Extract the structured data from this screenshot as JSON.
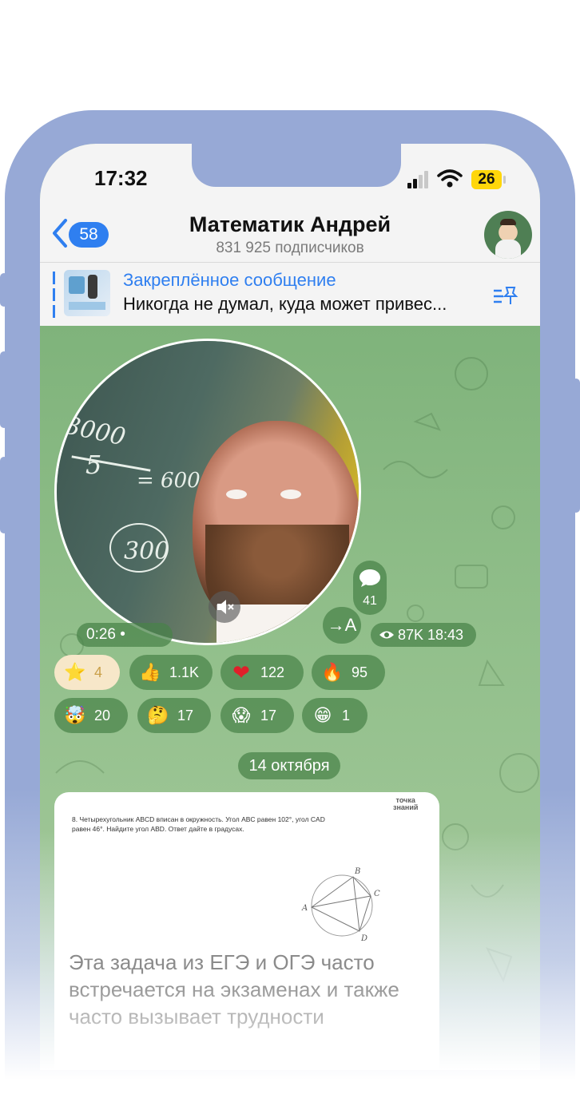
{
  "status_bar": {
    "time": "17:32",
    "battery": "26"
  },
  "header": {
    "back_count": "58",
    "title": "Математик Андрей",
    "subtitle": "831 925 подписчиков"
  },
  "pinned": {
    "title": "Закреплённое сообщение",
    "text": "Никогда не думал, куда может привес..."
  },
  "video_message": {
    "chalk": [
      "3000",
      "5",
      "= 600",
      "300"
    ],
    "duration": "0:26 •",
    "comments": "41",
    "translate_label": "→A",
    "views_time": "87K 18:43"
  },
  "reactions": [
    {
      "emoji": "⭐",
      "count": "4",
      "active": true
    },
    {
      "emoji": "👍",
      "count": "1.1K"
    },
    {
      "emoji": "❤",
      "count": "122"
    },
    {
      "emoji": "🔥",
      "count": "95"
    },
    {
      "emoji": "🤯",
      "count": "20"
    },
    {
      "emoji": "🤔",
      "count": "17"
    },
    {
      "emoji": "😱",
      "count": "17"
    },
    {
      "emoji": "😁",
      "count": "1"
    }
  ],
  "date_separator": "14 октября",
  "post": {
    "logo_line1": "точка",
    "logo_line2": "знаний",
    "question": "8. Четырехугольник ABCD вписан в окружность. Угол ABC равен 102°, угол CAD равен 46°. Найдите угол ABD. Ответ дайте в градусах.",
    "diagram_labels": [
      "A",
      "B",
      "C",
      "D"
    ],
    "text": "Эта задача из ЕГЭ и ОГЭ часто встречается на экзаменах и также часто вызывает трудности"
  },
  "colors": {
    "accent": "#2f7ff0",
    "frame": "#97a9d6",
    "reaction_bg": "#4a824a"
  }
}
